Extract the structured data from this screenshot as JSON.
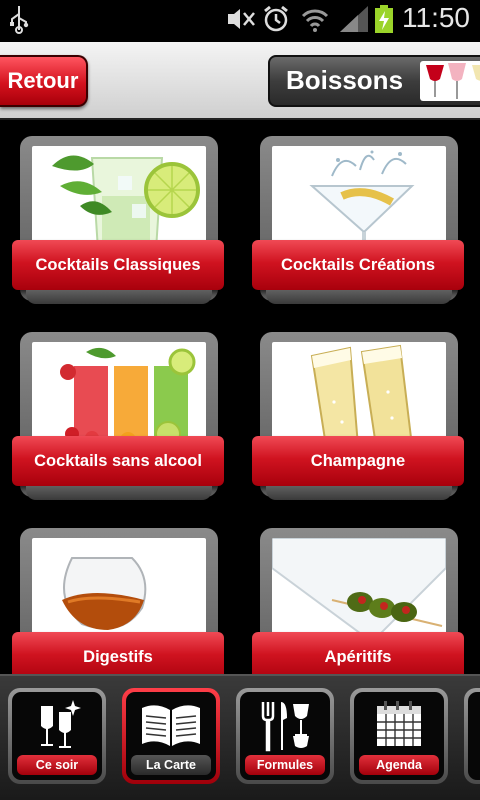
{
  "status_bar": {
    "time": "11:50"
  },
  "header": {
    "back_label": "Retour",
    "title": "Boissons"
  },
  "categories": [
    {
      "label": "Cocktails Classiques"
    },
    {
      "label": "Cocktails Créations"
    },
    {
      "label": "Cocktails sans alcool"
    },
    {
      "label": "Champagne"
    },
    {
      "label": "Digestifs"
    },
    {
      "label": "Apéritifs"
    }
  ],
  "tabs": [
    {
      "label": "Ce soir",
      "icon": "champagne-glasses-icon",
      "active": false
    },
    {
      "label": "La Carte",
      "icon": "open-menu-book-icon",
      "active": true
    },
    {
      "label": "Formules",
      "icon": "cutlery-icon",
      "active": false
    },
    {
      "label": "Agenda",
      "icon": "calendar-icon",
      "active": false
    }
  ],
  "colors": {
    "accent_red": "#d01320",
    "dark_bg": "#000000"
  }
}
